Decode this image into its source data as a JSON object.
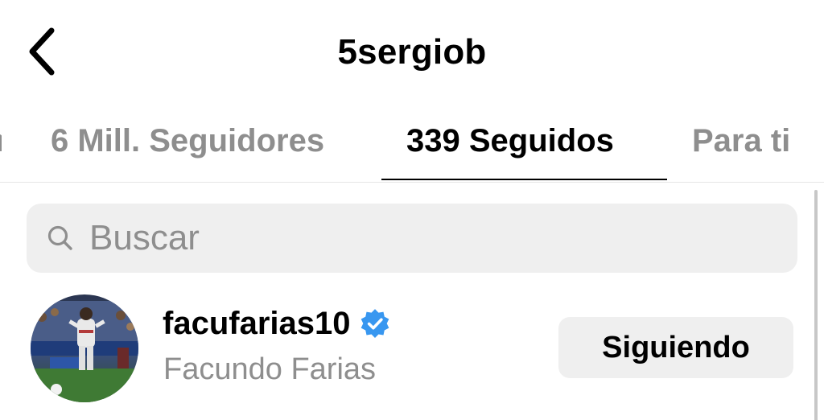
{
  "header": {
    "title": "5sergiob",
    "back_icon": "chevron-left-icon"
  },
  "tabs": [
    {
      "label": "6 Mill. Seguidores",
      "active": false
    },
    {
      "label": "339 Seguidos",
      "active": true
    },
    {
      "label": "Para ti",
      "active": false
    }
  ],
  "search": {
    "placeholder": "Buscar",
    "value": "",
    "icon": "search-icon"
  },
  "users": [
    {
      "username": "facufarias10",
      "full_name": "Facundo Farias",
      "verified": true,
      "button_label": "Siguiendo"
    }
  ],
  "colors": {
    "text_primary": "#000000",
    "text_secondary": "#8e8e8e",
    "surface": "#efefef",
    "verified_blue": "#3897f0"
  }
}
